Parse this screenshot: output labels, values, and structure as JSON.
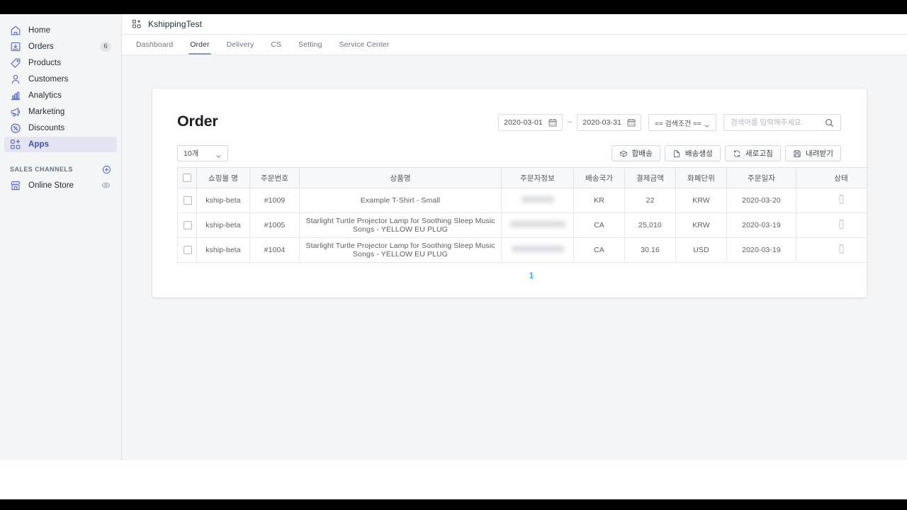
{
  "sidebar": {
    "items": [
      {
        "label": "Home",
        "icon": "home-icon",
        "badge": ""
      },
      {
        "label": "Orders",
        "icon": "orders-inbox-icon",
        "badge": "6"
      },
      {
        "label": "Products",
        "icon": "products-tag-icon",
        "badge": ""
      },
      {
        "label": "Customers",
        "icon": "customers-person-icon",
        "badge": ""
      },
      {
        "label": "Analytics",
        "icon": "analytics-bar-chart-icon",
        "badge": ""
      },
      {
        "label": "Marketing",
        "icon": "marketing-megaphone-icon",
        "badge": ""
      },
      {
        "label": "Discounts",
        "icon": "discounts-percent-icon",
        "badge": ""
      },
      {
        "label": "Apps",
        "icon": "apps-grid-plus-icon",
        "badge": ""
      }
    ],
    "active_item": "Apps",
    "sales_channels": {
      "title": "SALES CHANNELS",
      "add_icon": "plus-circle-icon",
      "items": [
        {
          "label": "Online Store",
          "icon": "online-store-icon",
          "action_icon": "eye-icon"
        }
      ]
    }
  },
  "header": {
    "app_icon": "apps-grid-plus-icon",
    "title": "KshippingTest"
  },
  "tabs": [
    {
      "label": "Dashboard",
      "active": false
    },
    {
      "label": "Order",
      "active": true
    },
    {
      "label": "Delivery",
      "active": false
    },
    {
      "label": "CS",
      "active": false
    },
    {
      "label": "Setting",
      "active": false
    },
    {
      "label": "Service Center",
      "active": false
    }
  ],
  "page": {
    "title": "Order"
  },
  "filters": {
    "date_from": "2020-03-01",
    "date_to": "2020-03-31",
    "range_separator": "~",
    "calendar_icon": "calendar-icon",
    "condition_selected": "== 검색조건 ==",
    "condition_chevron": "chevron-down-icon",
    "search_value": "",
    "search_placeholder": "검색어를 입력해주세요.",
    "search_icon": "search-icon"
  },
  "toolbar": {
    "page_size_value": "10개",
    "page_size_chevron": "chevron-down-icon",
    "buttons": [
      {
        "label": "합배송",
        "icon": "merge-shipping-icon"
      },
      {
        "label": "배송생성",
        "icon": "create-shipping-doc-icon"
      },
      {
        "label": "새로고침",
        "icon": "refresh-icon"
      },
      {
        "label": "내려받기",
        "icon": "download-save-icon"
      }
    ]
  },
  "table": {
    "select_all_checkbox": false,
    "columns": [
      {
        "key": "check",
        "label": ""
      },
      {
        "key": "mall",
        "label": "쇼핑몰 명"
      },
      {
        "key": "order_no",
        "label": "주문번호"
      },
      {
        "key": "product",
        "label": "상품명"
      },
      {
        "key": "orderer",
        "label": "주문자정보"
      },
      {
        "key": "country",
        "label": "배송국가"
      },
      {
        "key": "amount",
        "label": "결제금액"
      },
      {
        "key": "currency",
        "label": "화폐단위"
      },
      {
        "key": "order_date",
        "label": "주문일자"
      },
      {
        "key": "status",
        "label": "상태"
      }
    ],
    "rows": [
      {
        "checked": false,
        "mall": "kship-beta",
        "order_no": "#1009",
        "product": "Example T-Shirt - Small",
        "orderer": "",
        "orderer_redacted": true,
        "orderer_redacted_width": 46,
        "country": "KR",
        "amount": "22",
        "currency": "KRW",
        "order_date": "2020-03-20",
        "status_icon": "tag-icon"
      },
      {
        "checked": false,
        "mall": "kship-beta",
        "order_no": "#1005",
        "product": "Starlight Turtle Projector Lamp for Soothing Sleep Music Songs - YELLOW EU PLUG",
        "orderer": "",
        "orderer_redacted": true,
        "orderer_redacted_width": 78,
        "country": "CA",
        "amount": "25,010",
        "currency": "KRW",
        "order_date": "2020-03-19",
        "status_icon": "tag-icon"
      },
      {
        "checked": false,
        "mall": "kship-beta",
        "order_no": "#1004",
        "product": "Starlight Turtle Projector Lamp for Soothing Sleep Music Songs - YELLOW EU PLUG",
        "orderer": "",
        "orderer_redacted": true,
        "orderer_redacted_width": 74,
        "country": "CA",
        "amount": "30.16",
        "currency": "USD",
        "order_date": "2020-03-19",
        "status_icon": "tag-icon"
      }
    ]
  },
  "pagination": {
    "current_page": "1"
  },
  "colors": {
    "brand_indigo": "#5c6ac4",
    "active_nav_bg": "#e4e5f3",
    "active_nav_text": "#3f4eae",
    "tab_underline": "#8a9ab5",
    "pagination_blue": "#3aabf0",
    "page_bg": "#f4f5f7",
    "card_bg": "#ffffff"
  }
}
